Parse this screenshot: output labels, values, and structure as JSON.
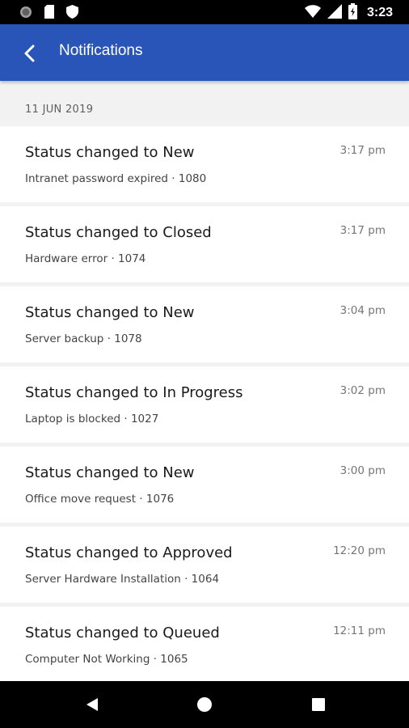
{
  "status_bar": {
    "time": "3:23"
  },
  "app_bar": {
    "title": "Notifications",
    "color": "#2a55b8"
  },
  "date_header": "11 JUN 2019",
  "notifications": [
    {
      "title": "Status changed to New",
      "subtitle": "Intranet password expired · 1080",
      "time": "3:17 pm"
    },
    {
      "title": "Status changed to Closed",
      "subtitle": "Hardware error · 1074",
      "time": "3:17 pm"
    },
    {
      "title": "Status changed to New",
      "subtitle": "Server backup · 1078",
      "time": "3:04 pm"
    },
    {
      "title": "Status changed to In Progress",
      "subtitle": "Laptop is blocked · 1027",
      "time": "3:02 pm"
    },
    {
      "title": "Status changed to New",
      "subtitle": "Office move request · 1076",
      "time": "3:00 pm"
    },
    {
      "title": "Status changed to Approved",
      "subtitle": "Server Hardware Installation · 1064",
      "time": "12:20 pm"
    },
    {
      "title": "Status changed to Queued",
      "subtitle": "Computer Not Working · 1065",
      "time": "12:11 pm"
    }
  ],
  "icons": {
    "back": "chevron-left-icon",
    "nav_back": "triangle-back-icon",
    "nav_home": "circle-home-icon",
    "nav_recents": "square-recents-icon"
  }
}
